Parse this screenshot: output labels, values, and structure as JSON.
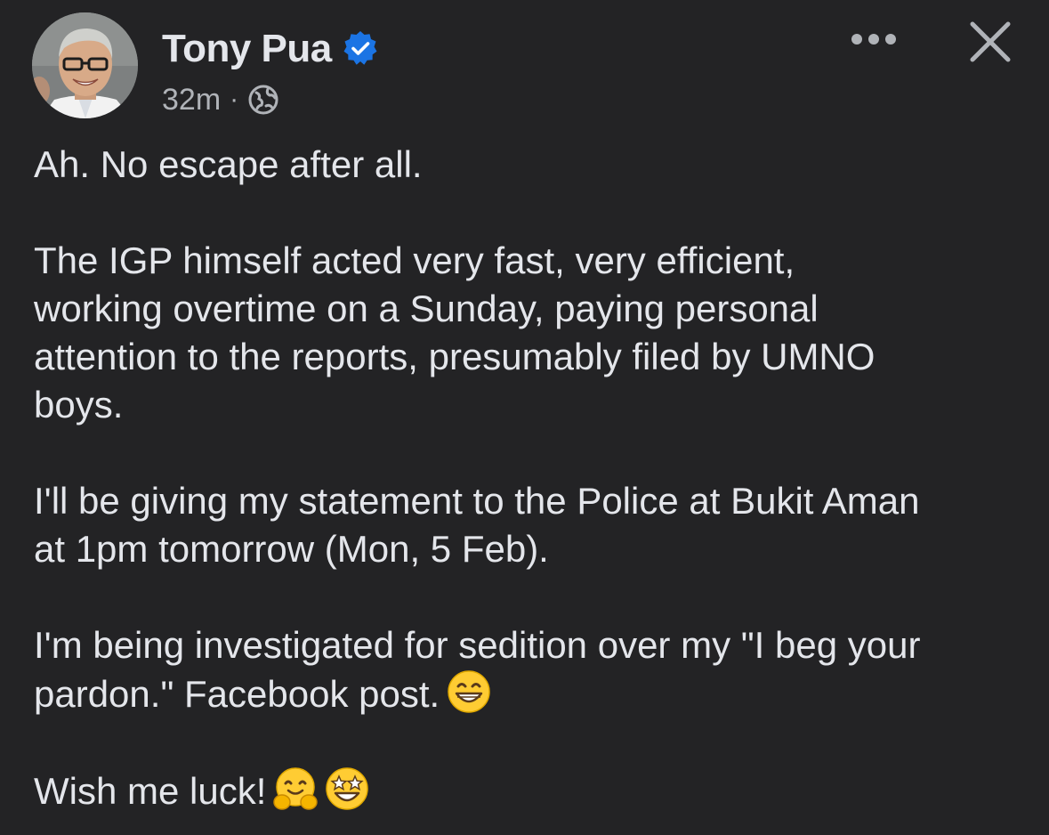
{
  "post": {
    "author": {
      "name": "Tony Pua",
      "verified": true
    },
    "timestamp": "32m",
    "separator": "·",
    "audience_icon": "globe-icon",
    "actions": {
      "more_icon": "more-dots-icon",
      "close_icon": "close-icon"
    },
    "paragraphs": [
      {
        "text": "Ah. No escape after all."
      },
      {
        "text": "The IGP himself acted very fast, very efficient,\nworking overtime on a Sunday, paying personal\nattention to the reports, presumably filed by UMNO\nboys."
      },
      {
        "text": "I'll be giving my statement to the Police at Bukit Aman\nat 1pm tomorrow (Mon, 5 Feb)."
      },
      {
        "text": "I'm being investigated for sedition over my \"I beg your\npardon.\" Facebook post.",
        "emojis": [
          "grinning-face-emoji"
        ]
      },
      {
        "text": "Wish me luck!",
        "emojis": [
          "hugging-face-emoji",
          "star-struck-emoji"
        ]
      }
    ]
  },
  "colors": {
    "background": "#232325",
    "text": "#e4e6eb",
    "secondary_text": "#b0b3b8",
    "verified_badge": "#1b74e4",
    "emoji_yellow": "#ffcc33"
  }
}
